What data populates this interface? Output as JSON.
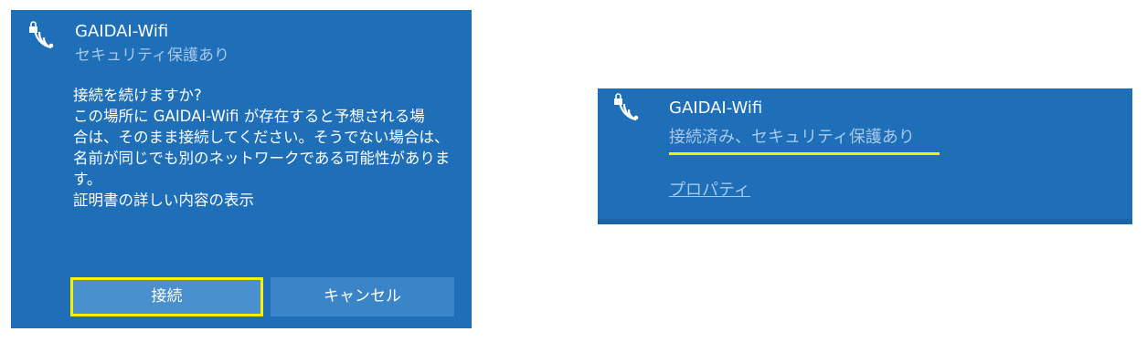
{
  "left_panel": {
    "icon": "wifi-secured-icon",
    "ssid": "GAIDAI-Wifi",
    "security": "セキュリティ保護あり",
    "question": "接続を続けますか?",
    "message_lines": [
      "この場所に GAIDAI-Wifi が存在すると予想される場",
      "合は、そのまま接続してください。そうでない場合は、",
      "名前が同じでも別のネットワークである可能性がありま",
      "す。"
    ],
    "cert_link": "証明書の詳しい内容の表示",
    "connect_label": "接続",
    "cancel_label": "キャンセル"
  },
  "right_panel": {
    "icon": "wifi-secured-icon",
    "ssid": "GAIDAI-Wifi",
    "status": "接続済み、セキュリティ保護あり",
    "properties_link": "プロパティ"
  },
  "colors": {
    "panel_bg": "#1e6eb8",
    "button_bg": "#4a8fce",
    "highlight": "#f7f000",
    "secondary_text": "#a8c8ea"
  }
}
